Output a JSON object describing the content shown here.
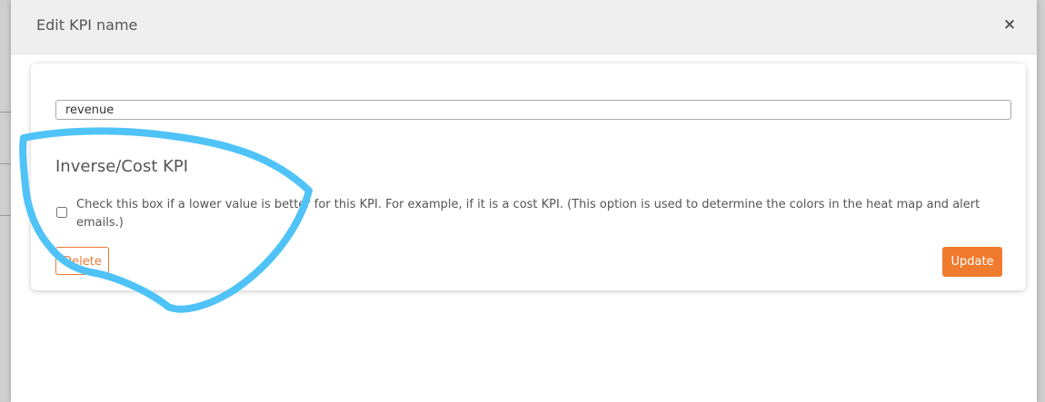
{
  "modal": {
    "title": "Edit KPI name",
    "close_label": "×"
  },
  "form": {
    "kpi_name_value": "revenue",
    "section_title": "Inverse/Cost KPI",
    "cost_checkbox_checked": false,
    "cost_help_text": "Check this box if a lower value is better for this KPI. For example, if it is a cost KPI. (This option is used to determine the colors in the heat map and alert emails.)",
    "delete_label": "Delete",
    "update_label": "Update"
  },
  "colors": {
    "accent": "#f07b2e",
    "annotation": "#4fc3f7"
  },
  "icons": {
    "close": "close-icon"
  }
}
